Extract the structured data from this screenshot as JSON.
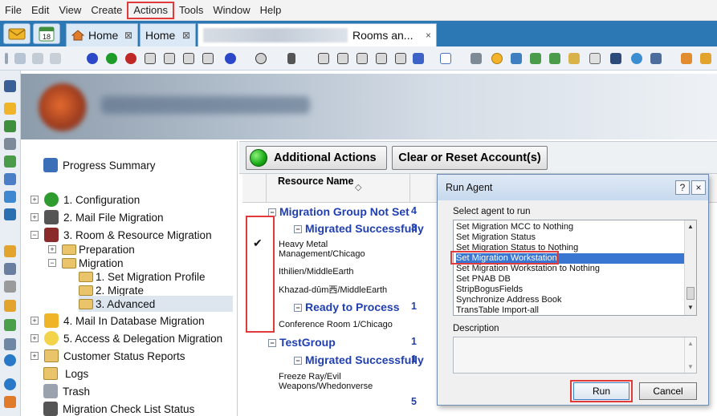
{
  "menu": [
    "File",
    "Edit",
    "View",
    "Create",
    "Actions",
    "Tools",
    "Window",
    "Help"
  ],
  "tabs": [
    {
      "label": "Home",
      "close": "⊠"
    },
    {
      "label": "Home",
      "close": "⊠"
    },
    {
      "label": "Rooms an...",
      "close": "×"
    }
  ],
  "app_icons": {
    "calendar_day": "18"
  },
  "nav": {
    "items": [
      {
        "label": "Progress Summary"
      },
      {
        "label": "1. Configuration",
        "expander": "+"
      },
      {
        "label": "2. Mail File Migration",
        "expander": "+"
      },
      {
        "label": "3. Room & Resource Migration",
        "expander": "−"
      },
      {
        "label": "Preparation",
        "expander": "+"
      },
      {
        "label": "Migration",
        "expander": "−"
      },
      {
        "label": "1. Set Migration Profile"
      },
      {
        "label": "2. Migrate"
      },
      {
        "label": "3. Advanced"
      },
      {
        "label": "4. Mail In Database Migration",
        "expander": "+"
      },
      {
        "label": "5. Access & Delegation Migration",
        "expander": "+"
      },
      {
        "label": "Customer Status Reports",
        "expander": "+"
      },
      {
        "label": "Logs"
      },
      {
        "label": "Trash"
      },
      {
        "label": "Migration Check List Status"
      }
    ]
  },
  "actions": {
    "additional_label": "Additional Actions",
    "clear_label": "Clear or Reset Account(s)"
  },
  "grid": {
    "header_resource": "Resource Name",
    "sort_glyph": "◇",
    "check_glyph": "✔",
    "collapse_glyph": "−",
    "groups": [
      {
        "label": "Migration Group Not Set",
        "count": "4"
      },
      {
        "label": "Migrated Successfully",
        "count": "3"
      },
      {
        "label": "Ready to Process",
        "count": "1"
      },
      {
        "label": "TestGroup",
        "count": "1"
      },
      {
        "label": "Migrated Successfully",
        "count": "1"
      }
    ],
    "rows": [
      {
        "line1": "Heavy Metal",
        "line2": "Management/Chicago"
      },
      {
        "line1": "Ithilien/MiddleEarth"
      },
      {
        "line1": "Khazad-dûm西/MiddleEarth"
      },
      {
        "line1": "Conference Room 1/Chicago"
      },
      {
        "line1": "Freeze Ray/Evil",
        "line2": "Weapons/Whedonverse"
      }
    ],
    "total": "5"
  },
  "dialog": {
    "title": "Run Agent",
    "help_glyph": "?",
    "close_glyph": "×",
    "select_label": "Select agent to run",
    "agents": [
      "Set Migration MCC to Nothing",
      "Set Migration Status",
      "Set Migration Status to Nothing",
      "Set Migration Workstation",
      "Set Migration Workstation to Nothing",
      "Set PNAB DB",
      "StripBogusFields",
      "Synchronize Address Book",
      "TransTable Import-all"
    ],
    "selected_index": 3,
    "scroll_up": "▲",
    "scroll_down": "▼",
    "description_label": "Description",
    "run_label": "Run",
    "cancel_label": "Cancel"
  },
  "colors": {
    "accent_red": "#e03a3a",
    "group_blue": "#1f3fb3",
    "selection_blue": "#3876d2",
    "tab_bar": "#2c78b5"
  }
}
